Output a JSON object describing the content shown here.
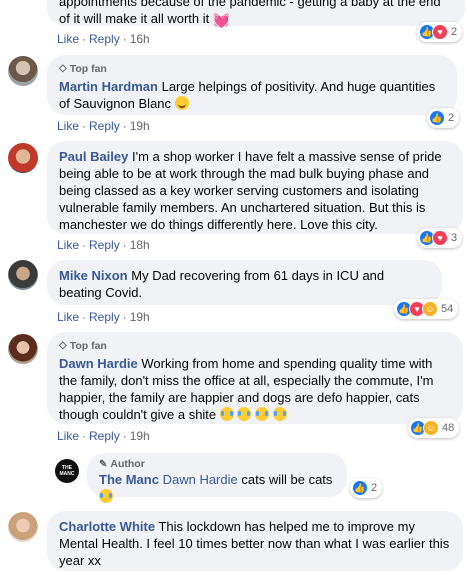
{
  "comments": [
    {
      "id": "top",
      "text": "appointments because of the pandemic - getting a baby at the end of it will make it all worth it",
      "actions": {
        "like": "Like",
        "reply": "Reply",
        "time": "16h"
      },
      "reactions": {
        "count": "2",
        "icons": [
          "like",
          "love"
        ]
      }
    },
    {
      "id": "martin",
      "badge": "Top fan",
      "name": "Martin Hardman",
      "text": "Large helpings of positivity. And huge quantities of Sauvignon Blanc",
      "actions": {
        "like": "Like",
        "reply": "Reply",
        "time": "19h"
      },
      "reactions": {
        "count": "2",
        "icons": [
          "like"
        ]
      }
    },
    {
      "id": "paul",
      "name": "Paul Bailey",
      "text": "I'm a shop worker I have felt a massive sense of pride being able to be at work through the mad bulk buying phase and being classed as a key worker serving customers and isolating vulnerable family members. An unchartered situation. But this is manchester we do things differently here. Love this city.",
      "actions": {
        "like": "Like",
        "reply": "Reply",
        "time": "18h"
      },
      "reactions": {
        "count": "3",
        "icons": [
          "like",
          "love"
        ]
      }
    },
    {
      "id": "mike",
      "name": "Mike Nixon",
      "text": "My Dad recovering from 61 days in ICU and beating Covid.",
      "actions": {
        "like": "Like",
        "reply": "Reply",
        "time": "19h"
      },
      "reactions": {
        "count": "54",
        "icons": [
          "like",
          "love",
          "care"
        ]
      }
    },
    {
      "id": "dawn",
      "badge": "Top fan",
      "name": "Dawn Hardie",
      "text": "Working from home and spending quality time with the family, don't miss the office at all, especially the commute, I'm happier, the family are happier and dogs are defo happier, cats though couldn't give a shite",
      "actions": {
        "like": "Like",
        "reply": "Reply",
        "time": "19h"
      },
      "reactions": {
        "count": "48",
        "icons": [
          "like",
          "haha"
        ]
      }
    },
    {
      "id": "manc",
      "badge": "Author",
      "name": "The Manc",
      "mention": "Dawn Hardie",
      "text": "cats will be cats",
      "avatar_text": "THE MANC",
      "reactions": {
        "count": "2",
        "icons": [
          "like"
        ]
      }
    },
    {
      "id": "charlotte",
      "name": "Charlotte White",
      "text": "This lockdown has helped me to improve my Mental Health. I feel 10 times better now than what I was earlier this year xx"
    }
  ],
  "colors": {
    "link": "#385898",
    "bubble": "#f0f2f5",
    "like": "#1877f2",
    "love": "#f33e58"
  }
}
